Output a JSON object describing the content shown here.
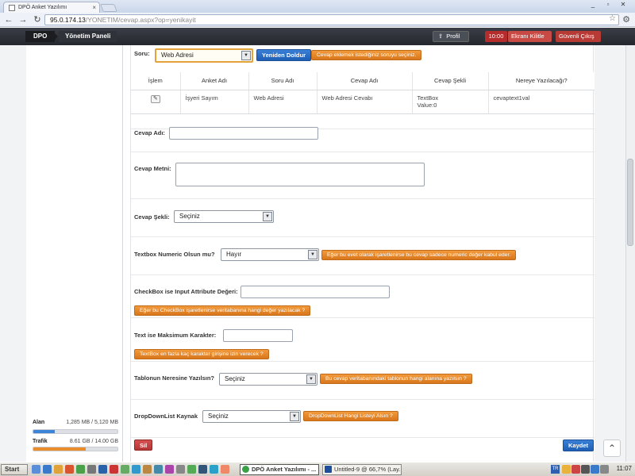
{
  "browser": {
    "tab_title": "DPÖ Anket Yazılımı",
    "tab_close": "×",
    "url_host": "95.0.174.13",
    "url_path": "/YONETIM/cevap.aspx?op=yenikayit",
    "win_min": "_",
    "win_max": "▫",
    "win_close": "✕"
  },
  "header": {
    "brand": "DPO",
    "panel": "Yönetim Paneli",
    "profile": "Profil",
    "time": "10:00",
    "lock": "Ekranı Kilitle",
    "logout": "Güvenli Çıkış"
  },
  "sidebar": {
    "stats": [
      {
        "label": "Alan",
        "value": "1,285 MB / 5,120 MB",
        "fill": 0.25,
        "color": "#3d83d6"
      },
      {
        "label": "Trafik",
        "value": "8.61 GB / 14.00 GB",
        "fill": 0.62,
        "color": "#ea8d2b"
      }
    ]
  },
  "form": {
    "soru": {
      "label": "Soru:",
      "selected": "Web Adresi",
      "refresh_button": "Yeniden Doldur",
      "hint": "Cevap eklemek istediğiniz soruyu seçiniz."
    },
    "table": {
      "headers": [
        "İşlem",
        "Anket Adı",
        "Soru Adı",
        "Cevap Adı",
        "Cevap Şekli",
        "Nereye Yazılacağı?"
      ],
      "rows": [
        {
          "edit": "✎",
          "anket": "İşyeri Sayım",
          "soru": "Web Adresi",
          "cevap": "Web Adresi Cevabı",
          "sekil_1": "TextBox",
          "sekil_2": "Value:0",
          "nereye": "cevaptext1val"
        }
      ]
    },
    "cevap_adi": {
      "label": "Cevap Adı:",
      "value": ""
    },
    "cevap_metni": {
      "label": "Cevap Metni:",
      "value": ""
    },
    "cevap_sekli": {
      "label": "Cevap Şekli:",
      "selected": "Seçiniz"
    },
    "textbox_numeric": {
      "label": "Textbox Numeric Olsun mu?",
      "selected": "Hayır",
      "hint": "Eğer bu evet olarak işaretlenirse bu cevap sadece numeric değer kabul eder."
    },
    "checkbox_attr": {
      "label": "CheckBox ise Input Attribute Değeri:",
      "value": "",
      "hint": "Eğer bu CheckBox işaretlenirse veritabanına hangi değer yazılacak ?"
    },
    "max_char": {
      "label": "Text ise Maksimum Karakter:",
      "value": "",
      "hint": "TextBox en fazla kaç karakter girişine izin verecek ?"
    },
    "tablo_neresi": {
      "label": "Tablonun Neresine Yazılsın?",
      "selected": "Seçiniz",
      "hint": "Bu cevap veritabanındaki tablonun hangi alanına yazılsın ?"
    },
    "dropdown_kaynak": {
      "label": "DropDownList Kaynak",
      "selected": "Seçiniz",
      "hint": "DropDownList Hangi Listeyi Alsın ?"
    },
    "delete_button": "Sil",
    "save_button": "Kaydet"
  },
  "taskbar": {
    "start": "Start",
    "tasks": [
      {
        "label": "DPÖ Anket Yazılımı - ...",
        "active": true,
        "color": "#3aa048"
      },
      {
        "label": "Untitled-9 @ 66,7% (Lay...",
        "active": false,
        "color": "#1e4f9a"
      }
    ],
    "tray_lang": "TR",
    "clock": "11:07"
  },
  "colors": {
    "accent_blue": "#1f5fb5",
    "hint_orange": "#d9761c",
    "danger_red": "#b53434",
    "header_dark": "#25282e"
  }
}
